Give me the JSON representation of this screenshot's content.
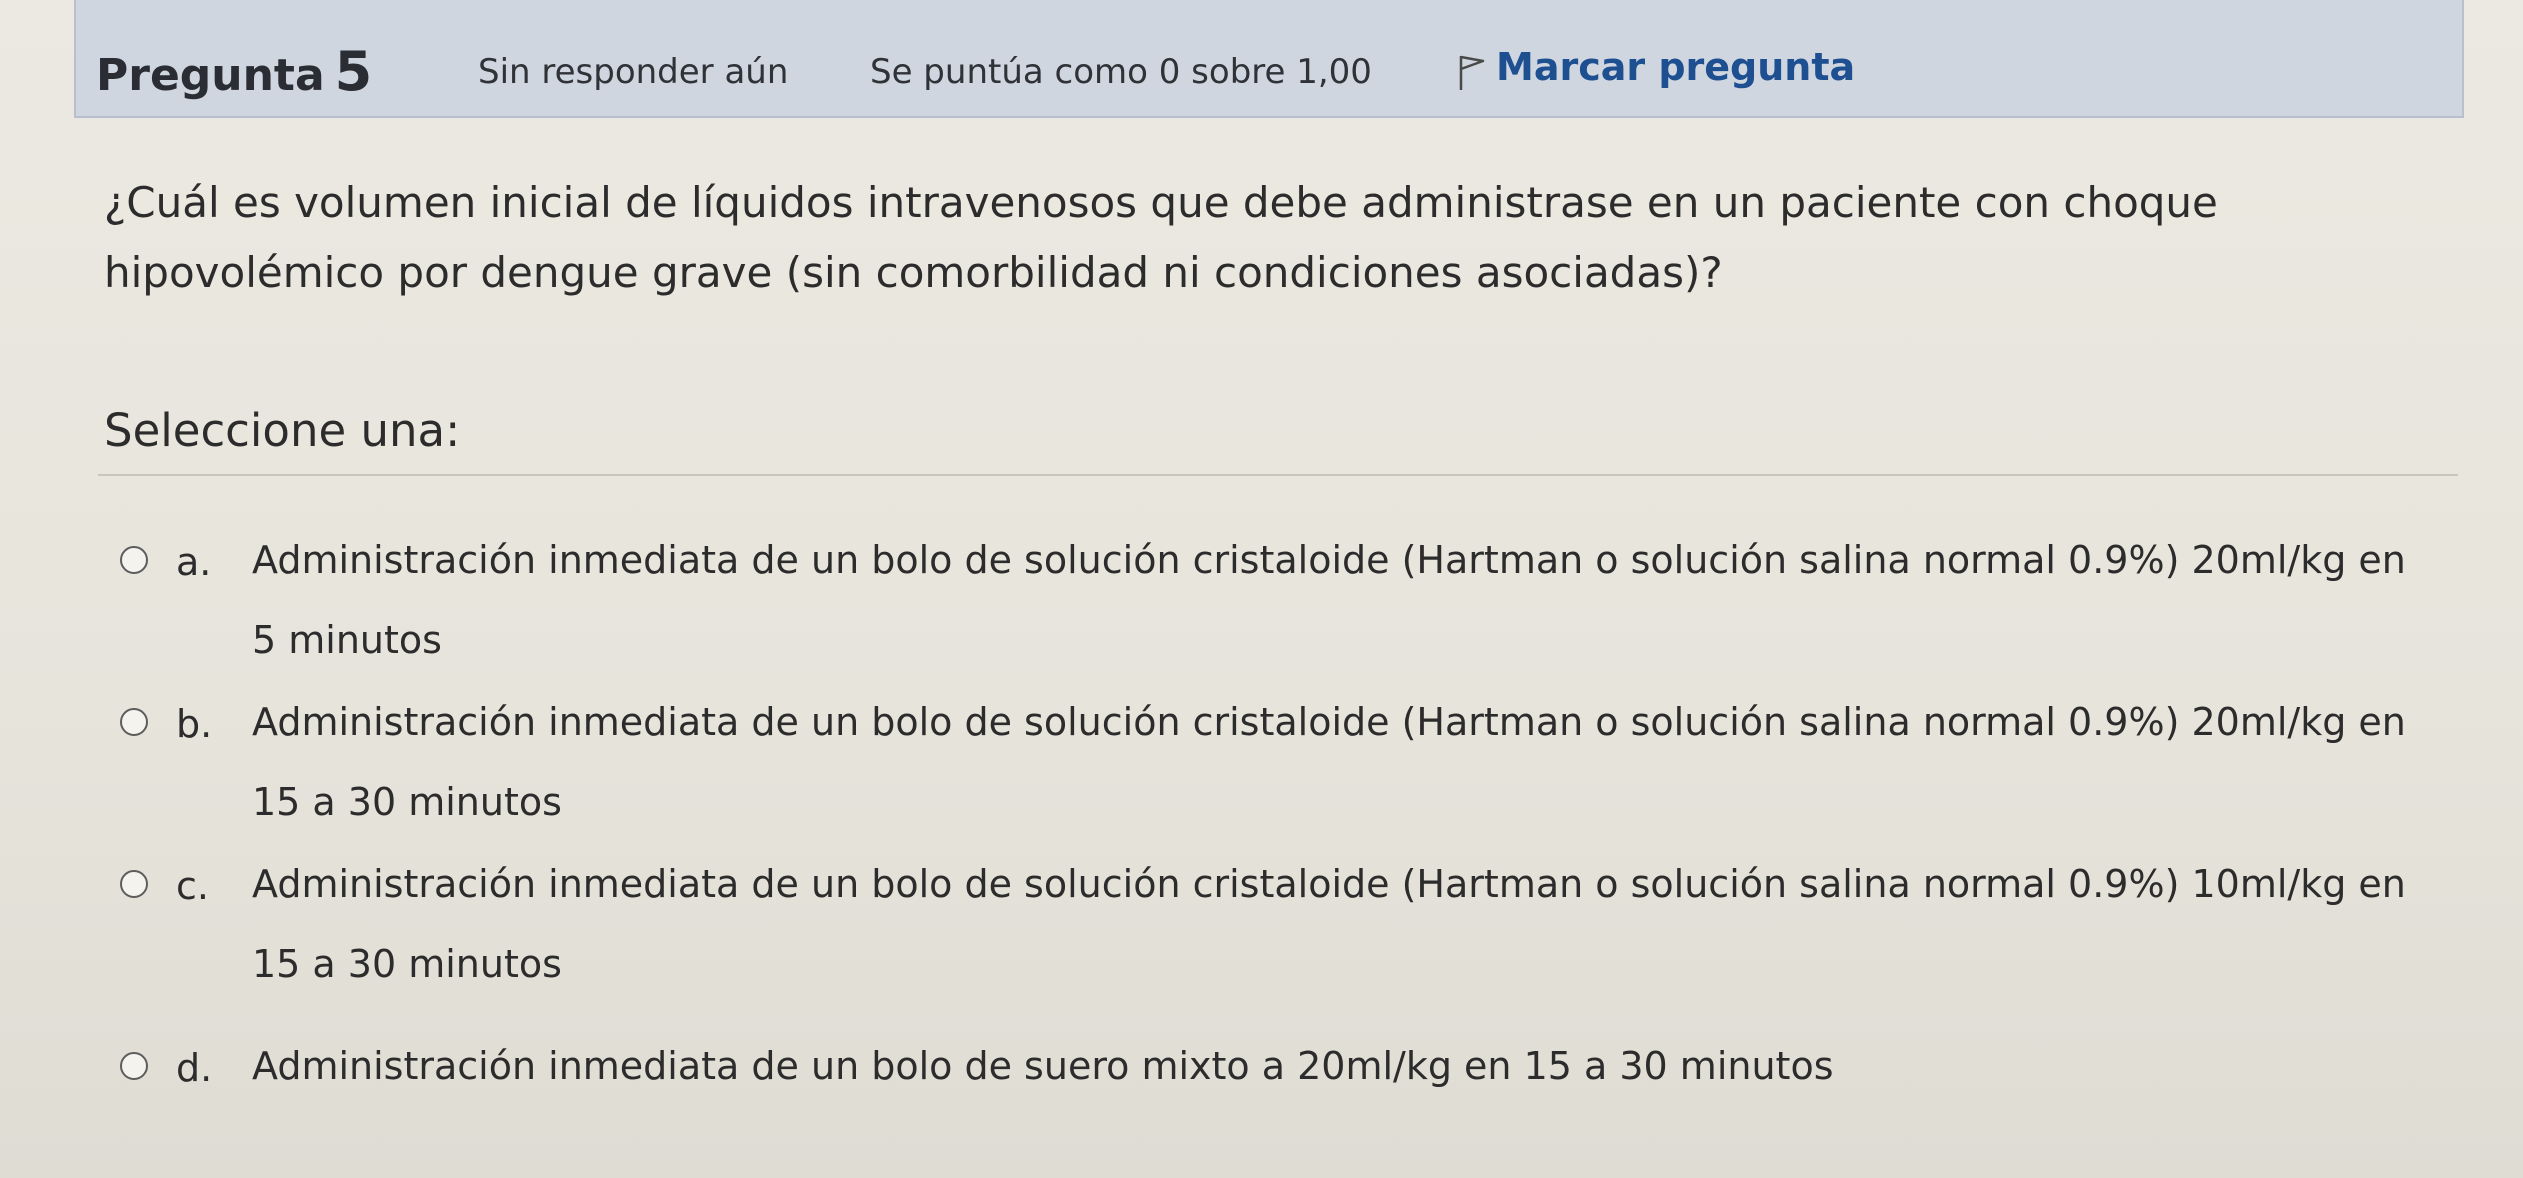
{
  "header": {
    "question_label": "Pregunta",
    "question_number": "5",
    "state": "Sin responder aún",
    "grade": "Se puntúa como 0 sobre 1,00",
    "flag_icon": "flag-icon",
    "flag_label": "Marcar pregunta"
  },
  "question": {
    "text": "¿Cuál es volumen inicial de líquidos intravenosos que debe administrase en un paciente con choque hipovolémico por dengue grave (sin comorbilidad ni condiciones asociadas)?",
    "prompt": "Seleccione una:"
  },
  "answers": [
    {
      "letter": "a.",
      "text": "Administración inmediata de un bolo de solución cristaloide (Hartman o solución salina normal 0.9%) 20ml/kg en 5 minutos",
      "selected": false
    },
    {
      "letter": "b.",
      "text": "Administración inmediata de un bolo de solución cristaloide (Hartman o solución salina normal 0.9%) 20ml/kg en 15 a 30 minutos",
      "selected": false
    },
    {
      "letter": "c.",
      "text": "Administración inmediata de un bolo de solución cristaloide (Hartman o solución salina normal 0.9%) 10ml/kg en 15 a 30 minutos",
      "selected": false
    },
    {
      "letter": "d.",
      "text": "Administración inmediata de un bolo de suero mixto a 20ml/kg en 15 a 30 minutos",
      "selected": false
    }
  ],
  "colors": {
    "info_bar": "#cfd6df",
    "flag_link": "#1d4f91",
    "page_background": "#e8e6dd"
  }
}
